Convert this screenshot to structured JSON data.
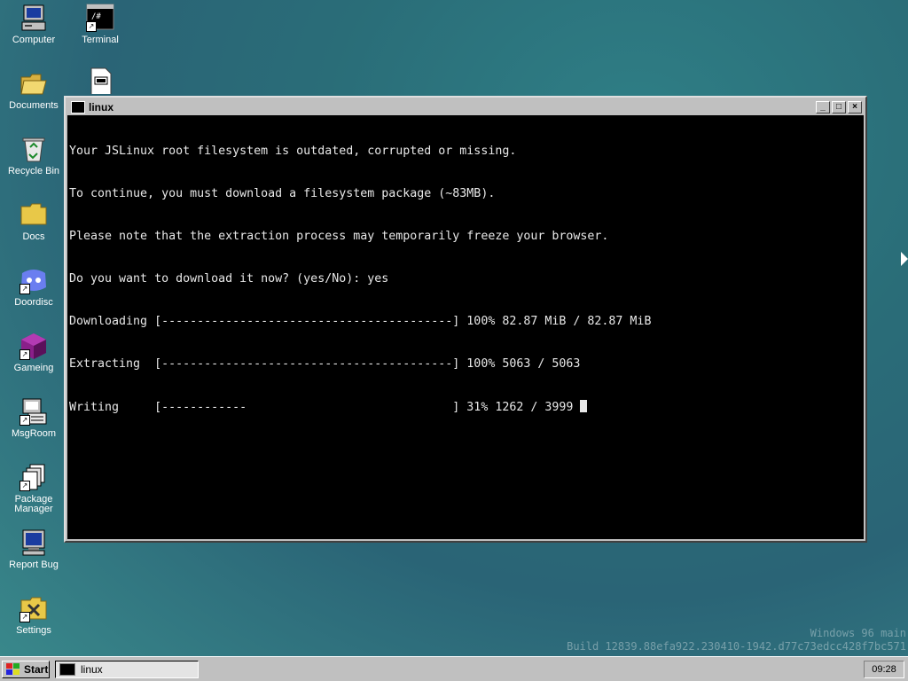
{
  "desktop": {
    "icons": [
      {
        "label": "Computer",
        "icon": "computer-icon"
      },
      {
        "label": "Terminal",
        "icon": "terminal-icon"
      },
      {
        "label": "Documents",
        "icon": "folder-open-icon"
      },
      {
        "label": "Recycle Bin",
        "icon": "recycle-bin-icon"
      },
      {
        "label": "Docs",
        "icon": "folder-icon"
      },
      {
        "label": "Doordisc",
        "icon": "chat-app-icon"
      },
      {
        "label": "Gameing",
        "icon": "cube-icon"
      },
      {
        "label": "MsgRoom",
        "icon": "messaging-icon"
      },
      {
        "label": "Package Manager",
        "icon": "package-icon"
      },
      {
        "label": "Report Bug",
        "icon": "monitor-icon"
      },
      {
        "label": "Settings",
        "icon": "settings-icon"
      }
    ],
    "extra_icon": "text-file-icon"
  },
  "window": {
    "title": "linux",
    "buttons": {
      "minimize": "_",
      "maximize": "□",
      "close": "×"
    },
    "terminal_lines": [
      "Your JSLinux root filesystem is outdated, corrupted or missing.",
      "To continue, you must download a filesystem package (~83MB).",
      "Please note that the extraction process may temporarily freeze your browser.",
      "Do you want to download it now? (yes/No): yes",
      "Downloading [-----------------------------------------] 100% 82.87 MiB / 82.87 MiB",
      "Extracting  [-----------------------------------------] 100% 5063 / 5063",
      "Writing     [------------                             ] 31% 1262 / 3999 "
    ]
  },
  "watermark": {
    "line1": "Windows 96 main",
    "line2": "Build 12839.88efa922.230410-1942.d77c73edcc428f7bc571"
  },
  "taskbar": {
    "start_label": "Start",
    "task_label": "linux",
    "clock": "09:28"
  }
}
